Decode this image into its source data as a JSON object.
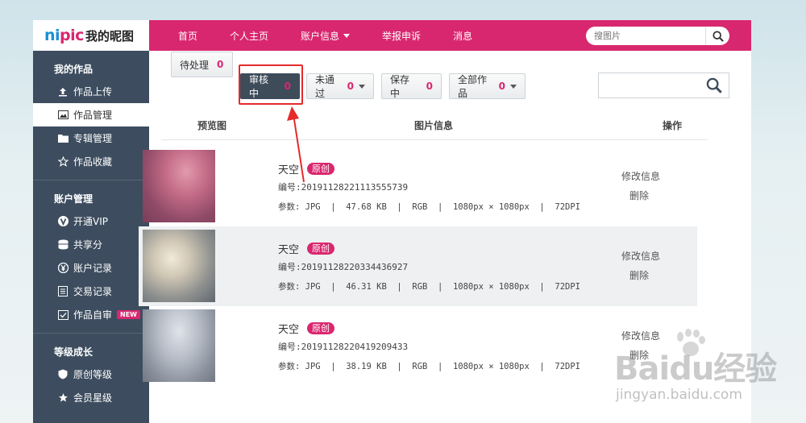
{
  "logo": {
    "brand_n": "ni",
    "brand_rest": "pic",
    "title": "我的昵图"
  },
  "nav": [
    "首页",
    "个人主页",
    "账户信息",
    "举报申诉",
    "消息"
  ],
  "top_search": {
    "placeholder": "搜图片"
  },
  "sidebar": {
    "sections": [
      {
        "title": "我的作品",
        "items": [
          {
            "label": "作品上传",
            "icon": "upload-icon"
          },
          {
            "label": "作品管理",
            "icon": "image-icon",
            "active": true
          },
          {
            "label": "专辑管理",
            "icon": "folder-icon"
          },
          {
            "label": "作品收藏",
            "icon": "star-outline-icon"
          }
        ]
      },
      {
        "title": "账户管理",
        "items": [
          {
            "label": "开通VIP",
            "icon": "vip-icon"
          },
          {
            "label": "共享分",
            "icon": "coins-icon"
          },
          {
            "label": "账户记录",
            "icon": "yen-icon"
          },
          {
            "label": "交易记录",
            "icon": "ledger-icon"
          },
          {
            "label": "作品自审",
            "icon": "review-icon",
            "badge": "NEW"
          }
        ]
      },
      {
        "title": "等级成长",
        "items": [
          {
            "label": "原创等级",
            "icon": "shield-icon"
          },
          {
            "label": "会员星级",
            "icon": "star-icon"
          }
        ]
      }
    ]
  },
  "tabs": [
    {
      "label": "待处理",
      "count": "0"
    },
    {
      "label": "审核中",
      "count": "0",
      "active": true
    },
    {
      "label": "未通过",
      "count": "0",
      "caret": true
    },
    {
      "label": "保存中",
      "count": "0"
    },
    {
      "label": "全部作品",
      "count": "0",
      "caret": true
    }
  ],
  "table": {
    "headers": {
      "preview": "预览图",
      "info": "图片信息",
      "ops": "操作"
    },
    "rows": [
      {
        "title": "天空",
        "tag": "原创",
        "id_label": "编号:",
        "id": "20191128221113555739",
        "params": "参数: JPG  |  47.68 KB  |  RGB  |  1080px × 1080px  |  72DPI"
      },
      {
        "title": "天空",
        "tag": "原创",
        "id_label": "编号:",
        "id": "20191128220334436927",
        "params": "参数: JPG  |  46.31 KB  |  RGB  |  1080px × 1080px  |  72DPI"
      },
      {
        "title": "天空",
        "tag": "原创",
        "id_label": "编号:",
        "id": "20191128220419209433",
        "params": "参数: JPG  |  38.19 KB  |  RGB  |  1080px × 1080px  |  72DPI"
      }
    ],
    "ops": {
      "edit": "修改信息",
      "delete": "删除"
    }
  },
  "watermark": {
    "main": "Baidu经验",
    "sub": "jingyan.baidu.com"
  },
  "colors": {
    "brand": "#d9276f",
    "sidebar": "#3d4d5f",
    "highlight": "#e52a2a"
  }
}
